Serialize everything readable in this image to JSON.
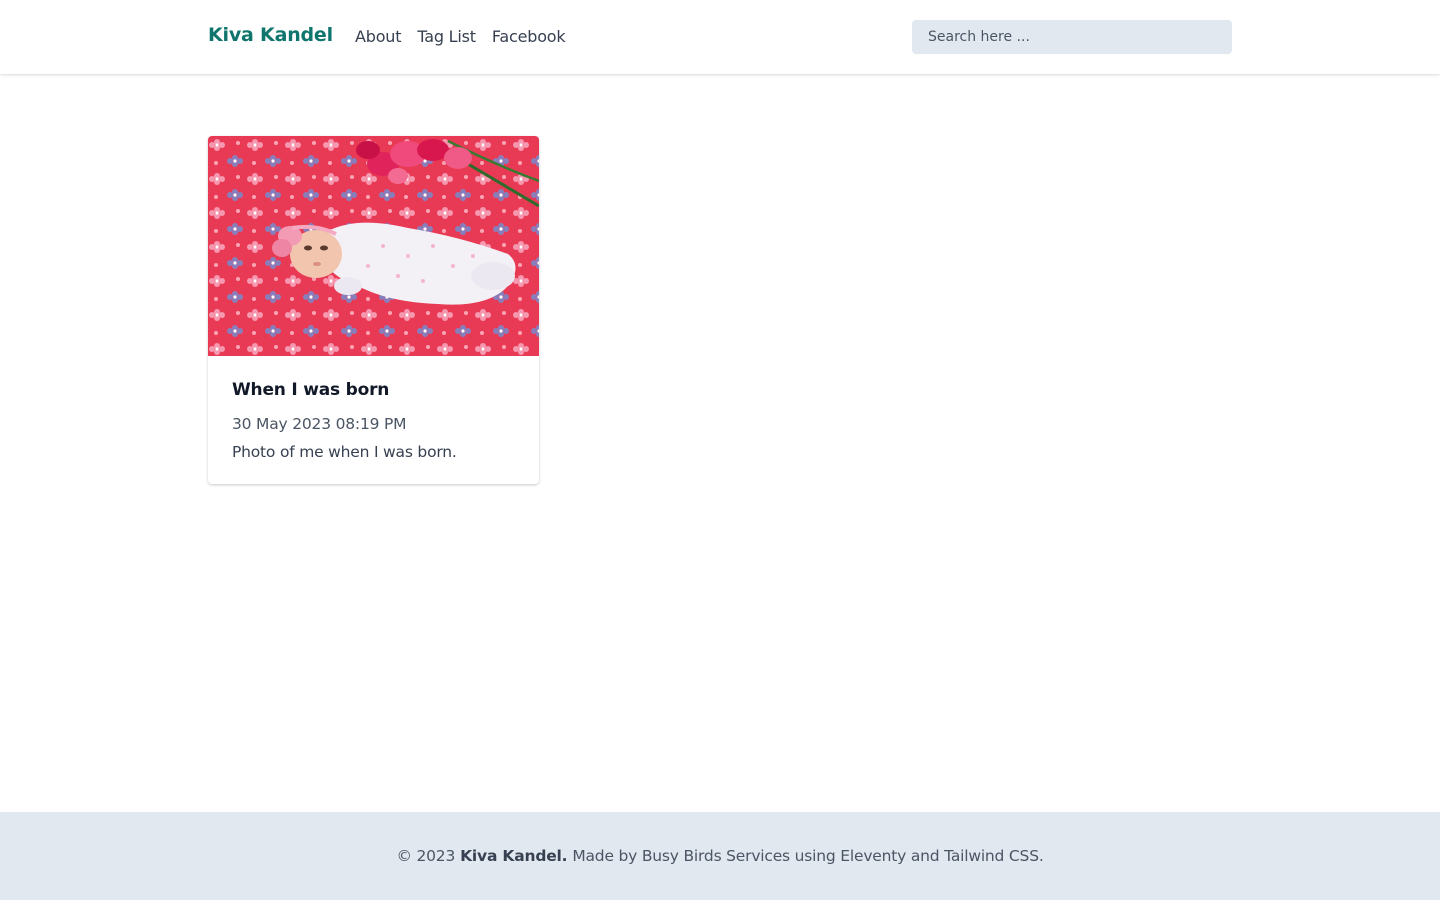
{
  "header": {
    "brand": "Kiva Kandel",
    "nav": [
      {
        "label": "About"
      },
      {
        "label": "Tag List"
      },
      {
        "label": "Facebook"
      }
    ],
    "search": {
      "placeholder": "Search here ..."
    }
  },
  "posts": [
    {
      "title": "When I was born",
      "date": "30 May 2023 08:19 PM",
      "description": "Photo of me when I was born."
    }
  ],
  "footer": {
    "copyright": "© 2023",
    "owner": "Kiva Kandel.",
    "text_made_by": "Made by",
    "maker": "Busy Birds Services",
    "text_using": "using",
    "tool1": "Eleventy",
    "text_and": "and",
    "tool2": "Tailwind CSS",
    "period": "."
  },
  "colors": {
    "brand": "#0f766e",
    "footer_bg": "#e2e8f0",
    "search_bg": "#e2e8f0"
  }
}
